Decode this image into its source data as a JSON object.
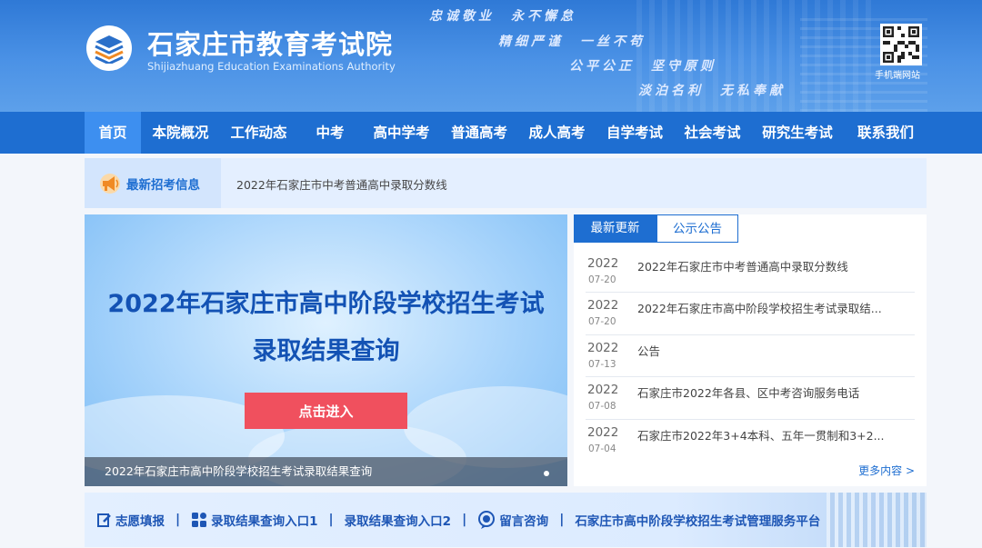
{
  "header": {
    "title": "石家庄市教育考试院",
    "subtitle": "Shijiazhuang Education Examinations Authority",
    "mottos": [
      "忠诚敬业　永不懈怠",
      "精细严谨　一丝不苟",
      "公平公正　坚守原则",
      "淡泊名利　无私奉献"
    ],
    "mobile_label": "手机端网站",
    "colors": {
      "header_blue": "#2f79d6",
      "nav_blue": "#1e6ed1",
      "accent_red": "#f0505e"
    }
  },
  "nav": {
    "items": [
      "首页",
      "本院概况",
      "工作动态",
      "中考",
      "高中学考",
      "普通高考",
      "成人高考",
      "自学考试",
      "社会考试",
      "研究生考试",
      "联系我们"
    ],
    "active": "首页"
  },
  "ticker": {
    "label": "最新招考信息",
    "text": "2022年石家庄市中考普通高中录取分数线"
  },
  "banner": {
    "title_line1": "2022年石家庄市高中阶段学校招生考试",
    "title_line2": "录取结果查询",
    "button": "点击进入",
    "caption": "2022年石家庄市高中阶段学校招生考试录取结果查询"
  },
  "news": {
    "tabs": [
      "最新更新",
      "公示公告"
    ],
    "items": [
      {
        "year": "2022",
        "md": "07-20",
        "title": "2022年石家庄市中考普通高中录取分数线"
      },
      {
        "year": "2022",
        "md": "07-20",
        "title": "2022年石家庄市高中阶段学校招生考试录取结..."
      },
      {
        "year": "2022",
        "md": "07-13",
        "title": "公告"
      },
      {
        "year": "2022",
        "md": "07-08",
        "title": "石家庄市2022年各县、区中考咨询服务电话"
      },
      {
        "year": "2022",
        "md": "07-04",
        "title": "石家庄市2022年3+4本科、五年一贯制和3+2..."
      }
    ],
    "more": "更多内容 >"
  },
  "bottom_links": [
    {
      "label": "志愿填报",
      "icon": "edit-icon"
    },
    {
      "label": "录取结果查询入口1",
      "icon": "grid-icon"
    },
    {
      "label": "录取结果查询入口2",
      "icon": ""
    },
    {
      "label": "留言咨询",
      "icon": "chat-icon"
    },
    {
      "label": "石家庄市高中阶段学校招生考试管理服务平台",
      "icon": ""
    }
  ],
  "separator": "|"
}
